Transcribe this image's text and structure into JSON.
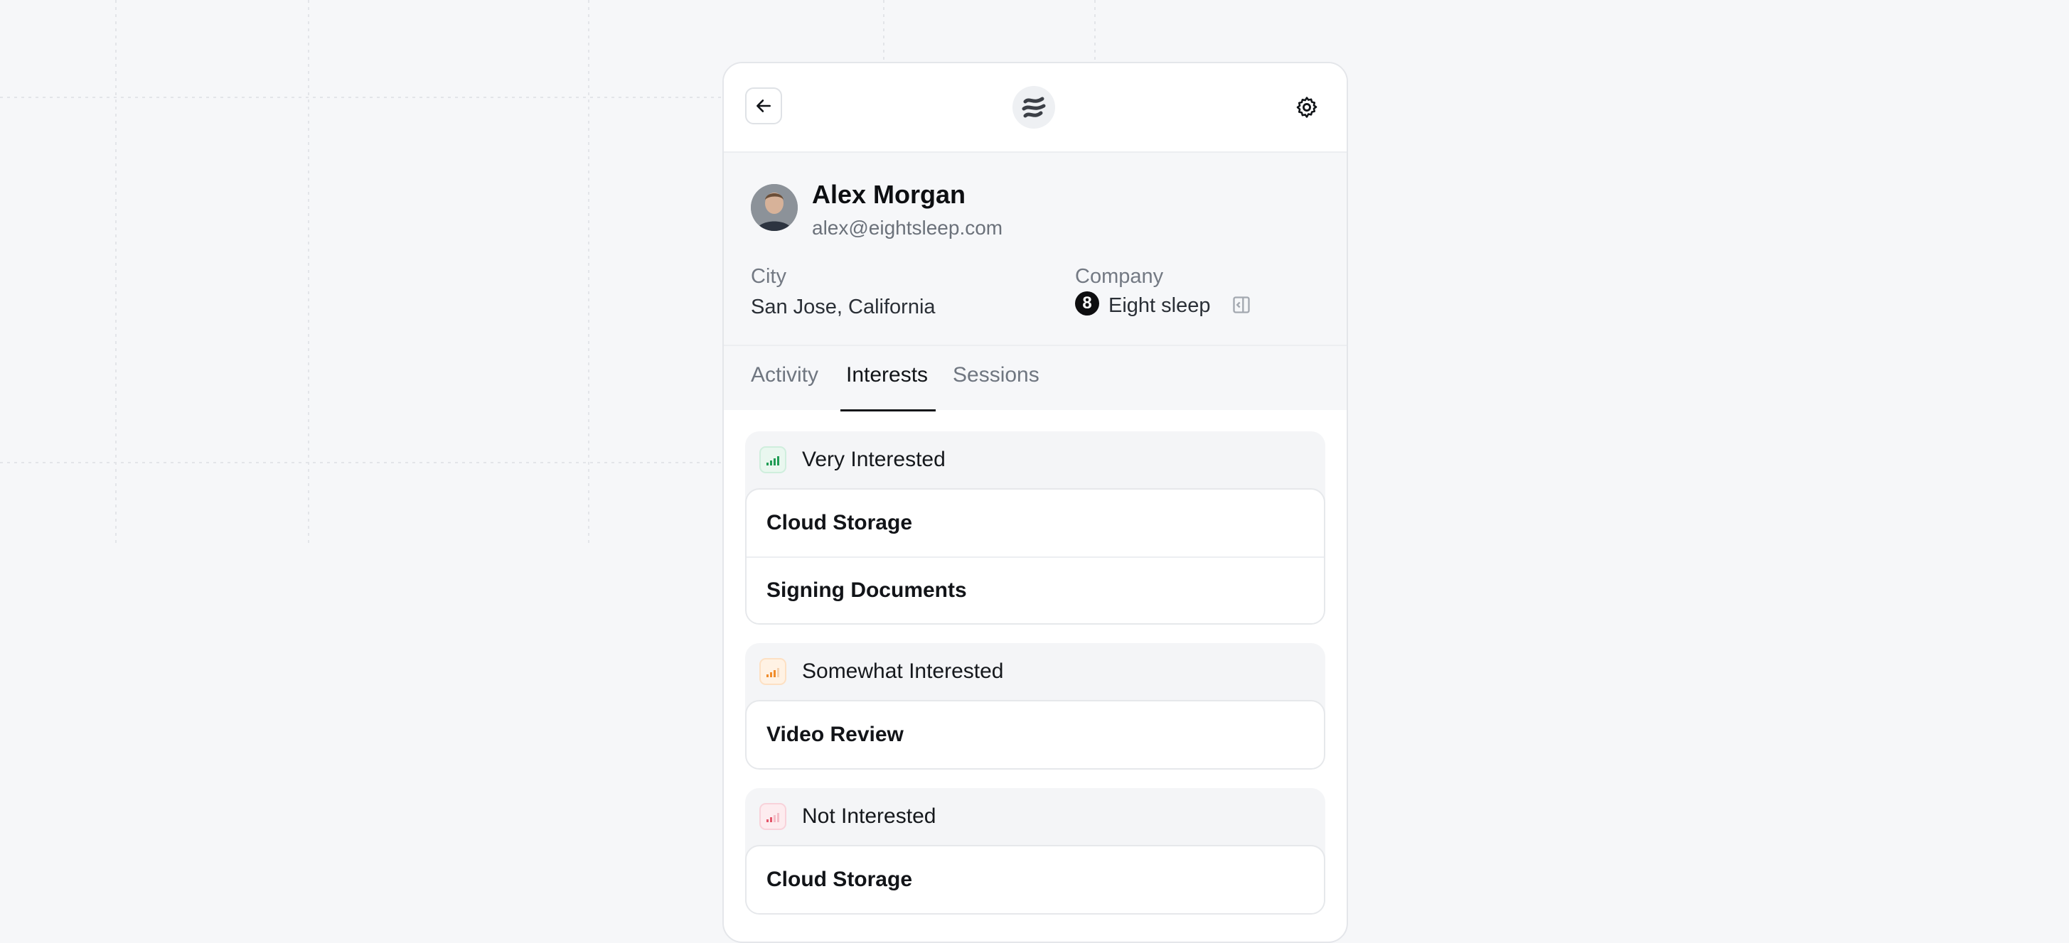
{
  "profile": {
    "name": "Alex Morgan",
    "email": "alex@eightsleep.com",
    "city_label": "City",
    "city_value": "San Jose, California",
    "company_label": "Company",
    "company_value": "Eight sleep",
    "company_logo_char": "8"
  },
  "tabs": [
    {
      "label": "Activity",
      "active": false
    },
    {
      "label": "Interests",
      "active": true
    },
    {
      "label": "Sessions",
      "active": false
    }
  ],
  "groups": [
    {
      "title": "Very Interested",
      "color": "#1f9d55",
      "bg": "#e9f7ef",
      "items": [
        "Cloud Storage",
        "Signing Documents"
      ]
    },
    {
      "title": "Somewhat Interested",
      "color": "#f08c2b",
      "bg": "#fff2e4",
      "items": [
        "Video Review"
      ]
    },
    {
      "title": "Not Interested",
      "color": "#e4576b",
      "bg": "#fdecef",
      "items": [
        "Cloud Storage"
      ]
    }
  ],
  "icons": {
    "back": "arrow-left-icon",
    "settings": "gear-icon",
    "logo": "app-logo",
    "panel": "sidebar-panel-icon"
  }
}
